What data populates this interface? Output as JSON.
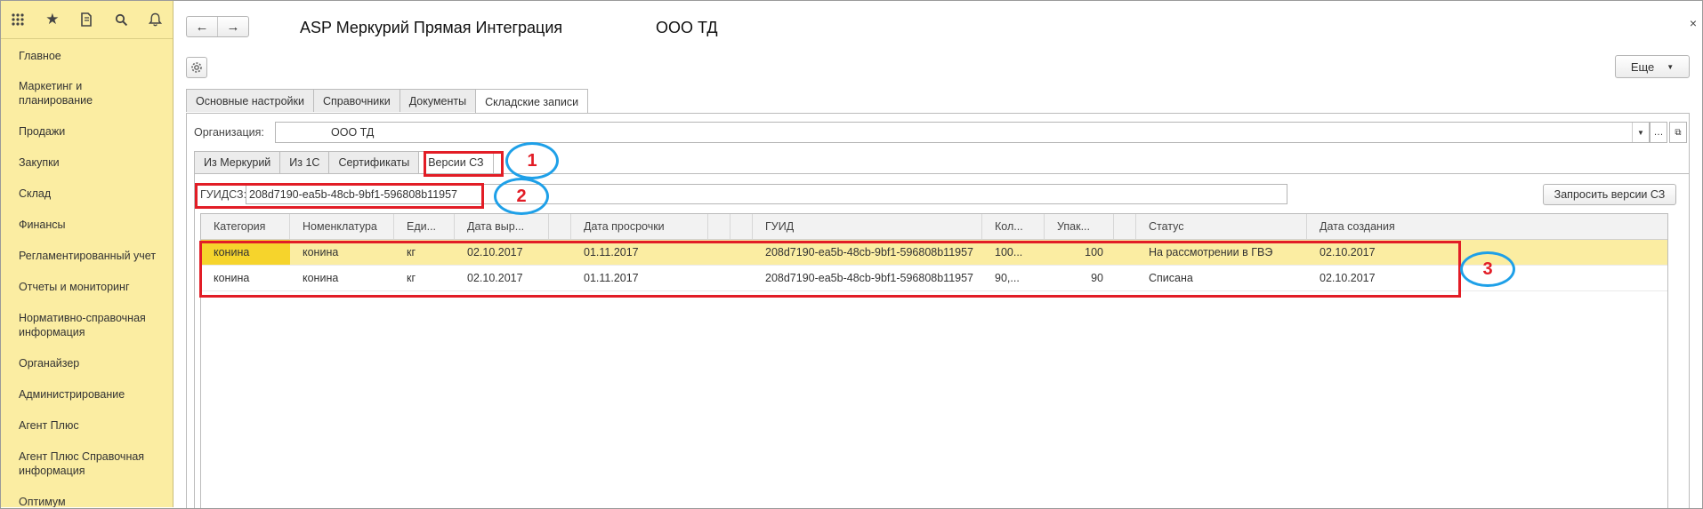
{
  "sidebar": {
    "icons": [
      "apps-grid-icon",
      "star-icon",
      "history-icon",
      "search-icon",
      "bell-icon"
    ],
    "items": [
      {
        "label": "Главное"
      },
      {
        "label": "Маркетинг и планирование"
      },
      {
        "label": "Продажи"
      },
      {
        "label": "Закупки"
      },
      {
        "label": "Склад"
      },
      {
        "label": "Финансы"
      },
      {
        "label": "Регламентированный учет"
      },
      {
        "label": "Отчеты и мониторинг"
      },
      {
        "label": "Нормативно-справочная информация"
      },
      {
        "label": "Органайзер"
      },
      {
        "label": "Администрирование"
      },
      {
        "label": "Агент Плюс"
      },
      {
        "label": "Агент Плюс Справочная информация"
      },
      {
        "label": "Оптимум"
      }
    ]
  },
  "header": {
    "title": "ASP Меркурий Прямая Интеграция",
    "org_title": "ООО ТД",
    "back_icon": "←",
    "forward_icon": "→",
    "close_icon": "×",
    "more_label": "Еще"
  },
  "tabs": [
    {
      "label": "Основные настройки"
    },
    {
      "label": "Справочники"
    },
    {
      "label": "Документы"
    },
    {
      "label": "Складские записи"
    }
  ],
  "org": {
    "label": "Организация:",
    "value": "ООО ТД"
  },
  "subtabs": [
    {
      "label": "Из Меркурий"
    },
    {
      "label": "Из 1С"
    },
    {
      "label": "Сертификаты"
    },
    {
      "label": "Версии СЗ"
    }
  ],
  "guid": {
    "label": "ГУИДСЗ:",
    "value": "208d7190-ea5b-48cb-9bf1-596808b11957",
    "request_button": "Запросить версии СЗ"
  },
  "table": {
    "headers": [
      "Категория",
      "Номенклатура",
      "Еди...",
      "Дата выр...",
      "",
      "Дата просрочки",
      "",
      "",
      "ГУИД",
      "Кол...",
      "Упак...",
      "",
      "Статус",
      "Дата создания"
    ],
    "rows": [
      [
        "конина",
        "конина",
        "кг",
        "02.10.2017",
        "",
        "01.11.2017",
        "",
        "",
        "208d7190-ea5b-48cb-9bf1-596808b11957",
        "100...",
        "100",
        "",
        "На рассмотрении в ГВЭ",
        "02.10.2017"
      ],
      [
        "конина",
        "конина",
        "кг",
        "02.10.2017",
        "",
        "01.11.2017",
        "",
        "",
        "208d7190-ea5b-48cb-9bf1-596808b11957",
        "90,...",
        "90",
        "",
        "Списана",
        "02.10.2017"
      ]
    ]
  },
  "annotations": {
    "n1": "1",
    "n2": "2",
    "n3": "3"
  },
  "colors": {
    "sidebar_bg": "#fbeda2",
    "selected_row": "#fbeda2",
    "current_cell": "#f6d42c",
    "annotation_red": "#e21d26",
    "annotation_blue": "#1ea0e8"
  }
}
